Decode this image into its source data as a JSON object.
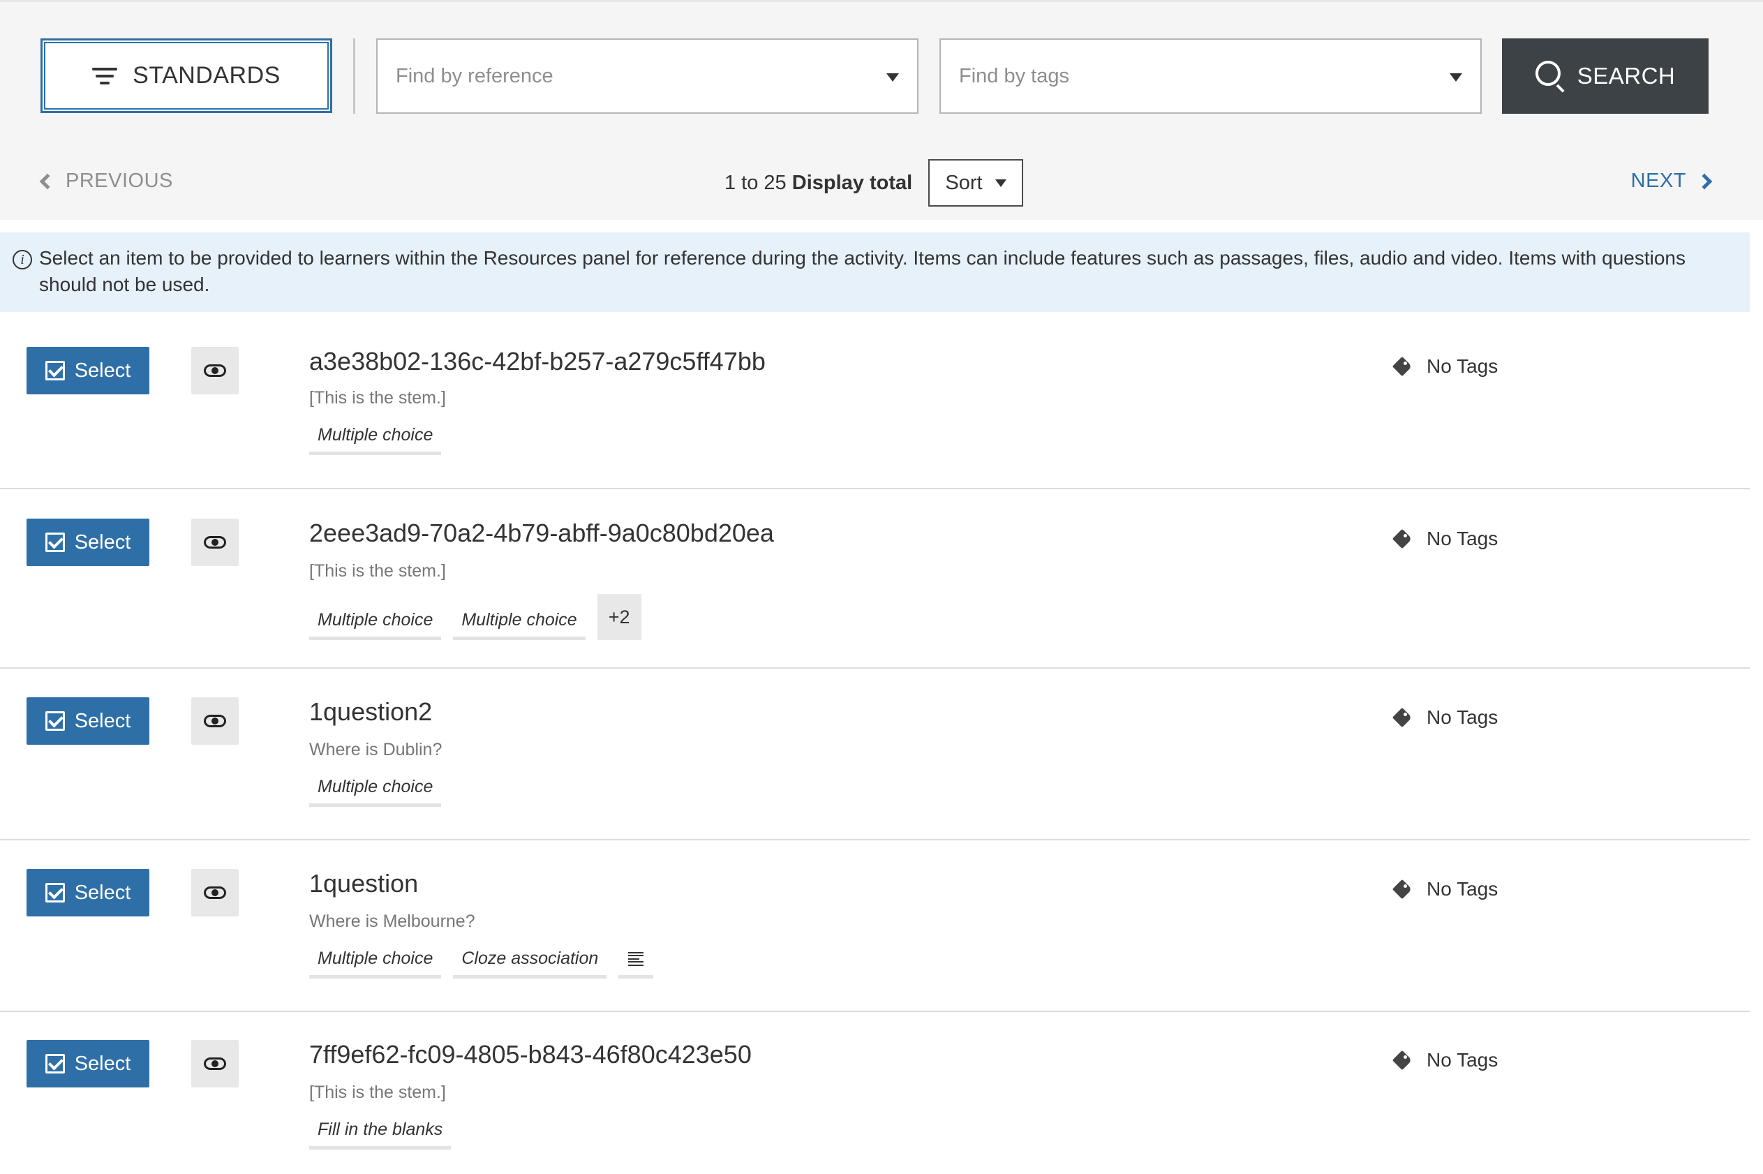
{
  "toolbar": {
    "standards_label": "STANDARDS",
    "reference_placeholder": "Find by reference",
    "tags_placeholder": "Find by tags",
    "search_label": "SEARCH"
  },
  "pagination": {
    "previous_label": "PREVIOUS",
    "next_label": "NEXT",
    "range": "1 to 25",
    "display_total": "Display total",
    "sort_label": "Sort"
  },
  "info_message": "Select an item to be provided to learners within the Resources panel for reference during the activity. Items can include features such as passages, files, audio and video. Items with questions should not be used.",
  "items": [
    {
      "select_label": "Select",
      "reference": "a3e38b02-136c-42bf-b257-a279c5ff47bb",
      "stem": "[This is the stem.]",
      "labels": [
        "Multiple choice"
      ],
      "tags": "No Tags"
    },
    {
      "select_label": "Select",
      "reference": "2eee3ad9-70a2-4b79-abff-9a0c80bd20ea",
      "stem": "[This is the stem.]",
      "labels": [
        "Multiple choice",
        "Multiple choice"
      ],
      "more": "+2",
      "tags": "No Tags"
    },
    {
      "select_label": "Select",
      "reference": "1question2",
      "stem": "Where is Dublin?",
      "labels": [
        "Multiple choice"
      ],
      "tags": "No Tags"
    },
    {
      "select_label": "Select",
      "reference": "1question",
      "stem": "Where is Melbourne?",
      "labels": [
        "Multiple choice",
        "Cloze association"
      ],
      "extra_icon": "text-lines-icon",
      "tags": "No Tags"
    },
    {
      "select_label": "Select",
      "reference": "7ff9ef62-fc09-4805-b843-46f80c423e50",
      "stem": "[This is the stem.]",
      "labels": [
        "Fill in the blanks"
      ],
      "tags": "No Tags"
    }
  ]
}
